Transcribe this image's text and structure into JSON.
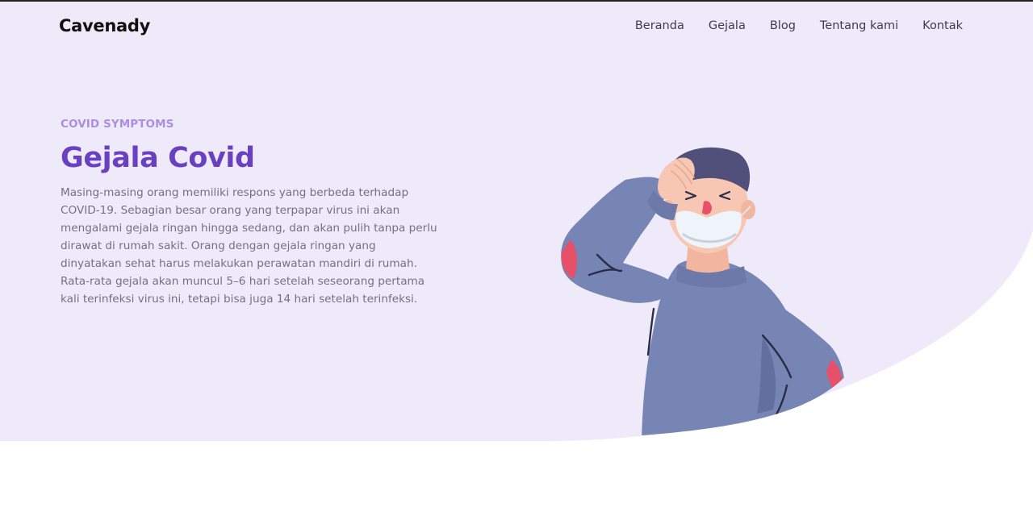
{
  "header": {
    "logo": "Cavenady",
    "nav": [
      "Beranda",
      "Gejala",
      "Blog",
      "Tentang kami",
      "Kontak"
    ]
  },
  "hero": {
    "eyebrow": "COVID SYMPTOMS",
    "title": "Gejala Covid",
    "description": "Masing-masing orang memiliki respons yang berbeda terhadap COVID-19. Sebagian besar orang yang terpapar virus ini akan mengalami gejala ringan hingga sedang, dan akan pulih tanpa perlu dirawat di rumah sakit. Orang dengan gejala ringan yang dinyatakan sehat harus melakukan perawatan mandiri di rumah. Rata-rata gejala akan muncul 5–6 hari setelah seseorang pertama kali terinfeksi virus ini, tetapi bisa juga 14 hari setelah terinfeksi."
  },
  "colors": {
    "hero_background": "#efeaf9",
    "accent": "#6a40c2",
    "eyebrow": "#a98fe0",
    "sweater": "#7785b4",
    "hair": "#50507a",
    "skin": "#f7c7b4",
    "mask": "#eef4f9",
    "patch": "#e65068"
  },
  "illustration": {
    "icon": "sick-person-illustration"
  }
}
